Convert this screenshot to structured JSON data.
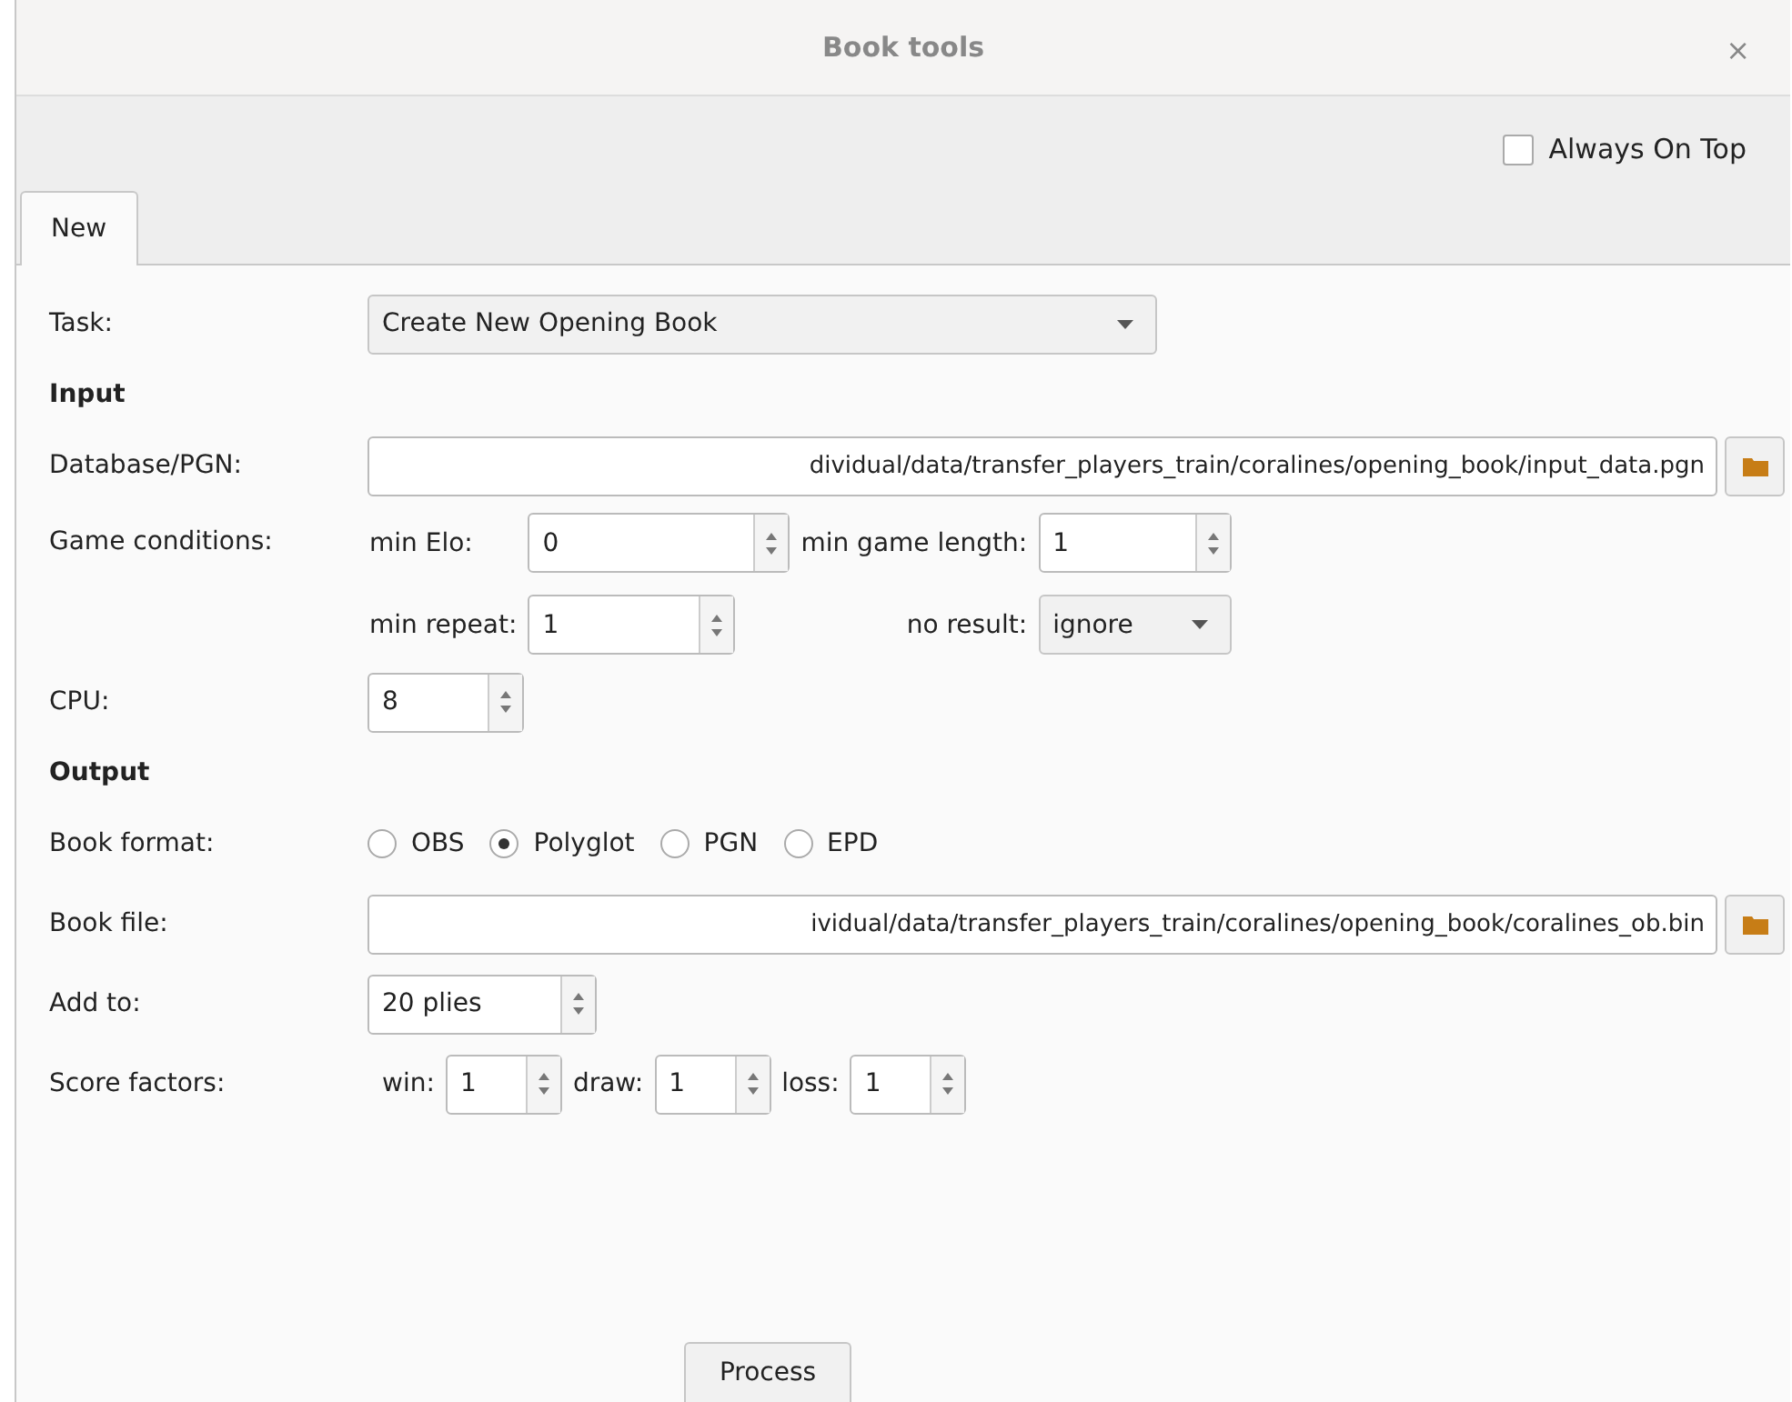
{
  "window": {
    "title": "Book tools",
    "close": "×"
  },
  "always_on_top": {
    "label": "Always On Top",
    "checked": false
  },
  "tabs": [
    {
      "label": "New",
      "selected": true
    }
  ],
  "task": {
    "label": "Task:",
    "value": "Create New Opening Book"
  },
  "input": {
    "heading": "Input",
    "database": {
      "label": "Database/PGN:",
      "value": "dividual/data/transfer_players_train/coralines/opening_book/input_data.pgn"
    },
    "game_conditions": {
      "label": "Game conditions:",
      "min_elo": {
        "label": "min Elo:",
        "value": "0"
      },
      "min_game_length": {
        "label": "min game length:",
        "value": "1"
      },
      "min_repeat": {
        "label": "min repeat:",
        "value": "1"
      },
      "no_result": {
        "label": "no result:",
        "value": "ignore"
      }
    },
    "cpu": {
      "label": "CPU:",
      "value": "8"
    }
  },
  "output": {
    "heading": "Output",
    "book_format": {
      "label": "Book format:",
      "options": [
        {
          "label": "OBS",
          "selected": false
        },
        {
          "label": "Polyglot",
          "selected": true
        },
        {
          "label": "PGN",
          "selected": false
        },
        {
          "label": "EPD",
          "selected": false
        }
      ]
    },
    "book_file": {
      "label": "Book file:",
      "value": "ividual/data/transfer_players_train/coralines/opening_book/coralines_ob.bin"
    },
    "add_to": {
      "label": "Add to:",
      "value": "20 plies"
    },
    "score_factors": {
      "label": "Score factors:",
      "items": [
        {
          "label": "win:",
          "value": "1"
        },
        {
          "label": "draw:",
          "value": "1"
        },
        {
          "label": "loss:",
          "value": "1"
        }
      ]
    }
  },
  "process_button": "Process"
}
